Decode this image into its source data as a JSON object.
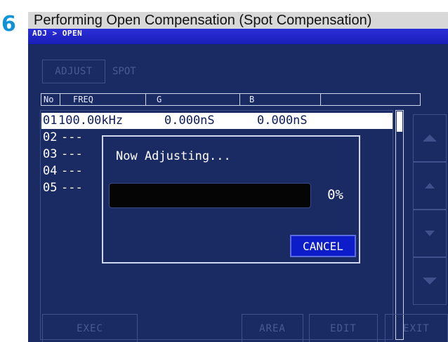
{
  "step": {
    "number": "6",
    "title": "Performing Open Compensation (Spot Compensation)"
  },
  "screen": {
    "breadcrumb": "ADJ > OPEN",
    "mode_buttons": {
      "adjust": "ADJUST",
      "spot": "SPOT"
    },
    "table": {
      "headers": [
        "No",
        "FREQ",
        "G",
        "B"
      ],
      "rows": [
        {
          "no": "01",
          "freq": "100.00kHz",
          "g": "0.000nS",
          "b": "0.000nS",
          "selected": true
        },
        {
          "no": "02",
          "freq": "---"
        },
        {
          "no": "03",
          "freq": "---"
        },
        {
          "no": "04",
          "freq": "---"
        },
        {
          "no": "05",
          "freq": "---"
        }
      ]
    },
    "dialog": {
      "message": "Now Adjusting...",
      "progress": 0,
      "percent_text": "0%",
      "cancel_label": "CANCEL"
    },
    "bottom_buttons": {
      "exec": "EXEC",
      "area": "AREA",
      "edit": "EDIT",
      "exit": "EXIT"
    },
    "side_icons": [
      "arrow-up-large-icon",
      "arrow-up-small-icon",
      "arrow-down-small-icon",
      "arrow-down-large-icon"
    ],
    "colors": {
      "screen_bg": "#1a2a63",
      "breadcrumb_bar": "#2a2ed8",
      "cancel_button": "#0b1cc8",
      "step_number": "#0f93d6"
    }
  }
}
